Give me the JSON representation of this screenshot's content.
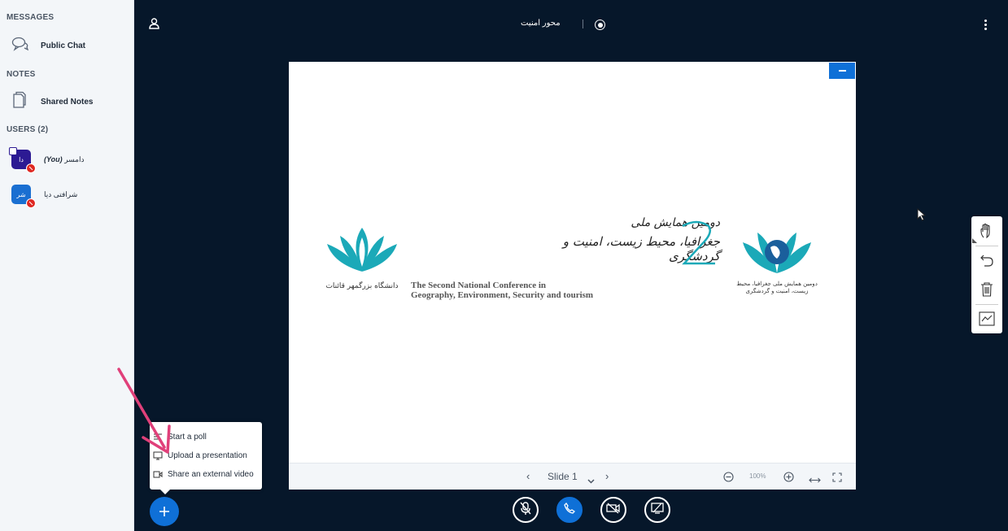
{
  "sidebar": {
    "messages_title": "MESSAGES",
    "public_chat": "Public Chat",
    "notes_title": "NOTES",
    "shared_notes": "Shared Notes",
    "users_title": "USERS (2)",
    "users": [
      {
        "name": "دامسر",
        "suffix": "(You)",
        "initials": "دا",
        "color": "#2c1a93"
      },
      {
        "name": "شرافتی دیا",
        "initials": "شر",
        "color": "#1a6fd1"
      }
    ]
  },
  "topbar": {
    "meeting_title": "محور امنیت"
  },
  "slide": {
    "title_fa_line1": "دومین همایش ملی",
    "title_fa_line2": "جغرافیا، محیط زیست، امنیت و گردشگری",
    "title_en_line1": "The Second National Conference in",
    "title_en_line2": "Geography, Environment, Security and tourism",
    "left_logo_text": "دانشگاه بزرگمهر قائنات",
    "right_logo_text": "دومین همایش ملی جغرافیا، محیط زیست، امنیت و گردشگری"
  },
  "slide_controls": {
    "slide_label": "Slide 1",
    "zoom": "100%"
  },
  "actions_menu": {
    "items": [
      "Start a poll",
      "Upload a presentation",
      "Share an external video"
    ]
  },
  "colors": {
    "accent": "#0f70d7",
    "background": "#06172a",
    "teal": "#1ba9b8",
    "annotation_arrow": "#e0407a"
  }
}
